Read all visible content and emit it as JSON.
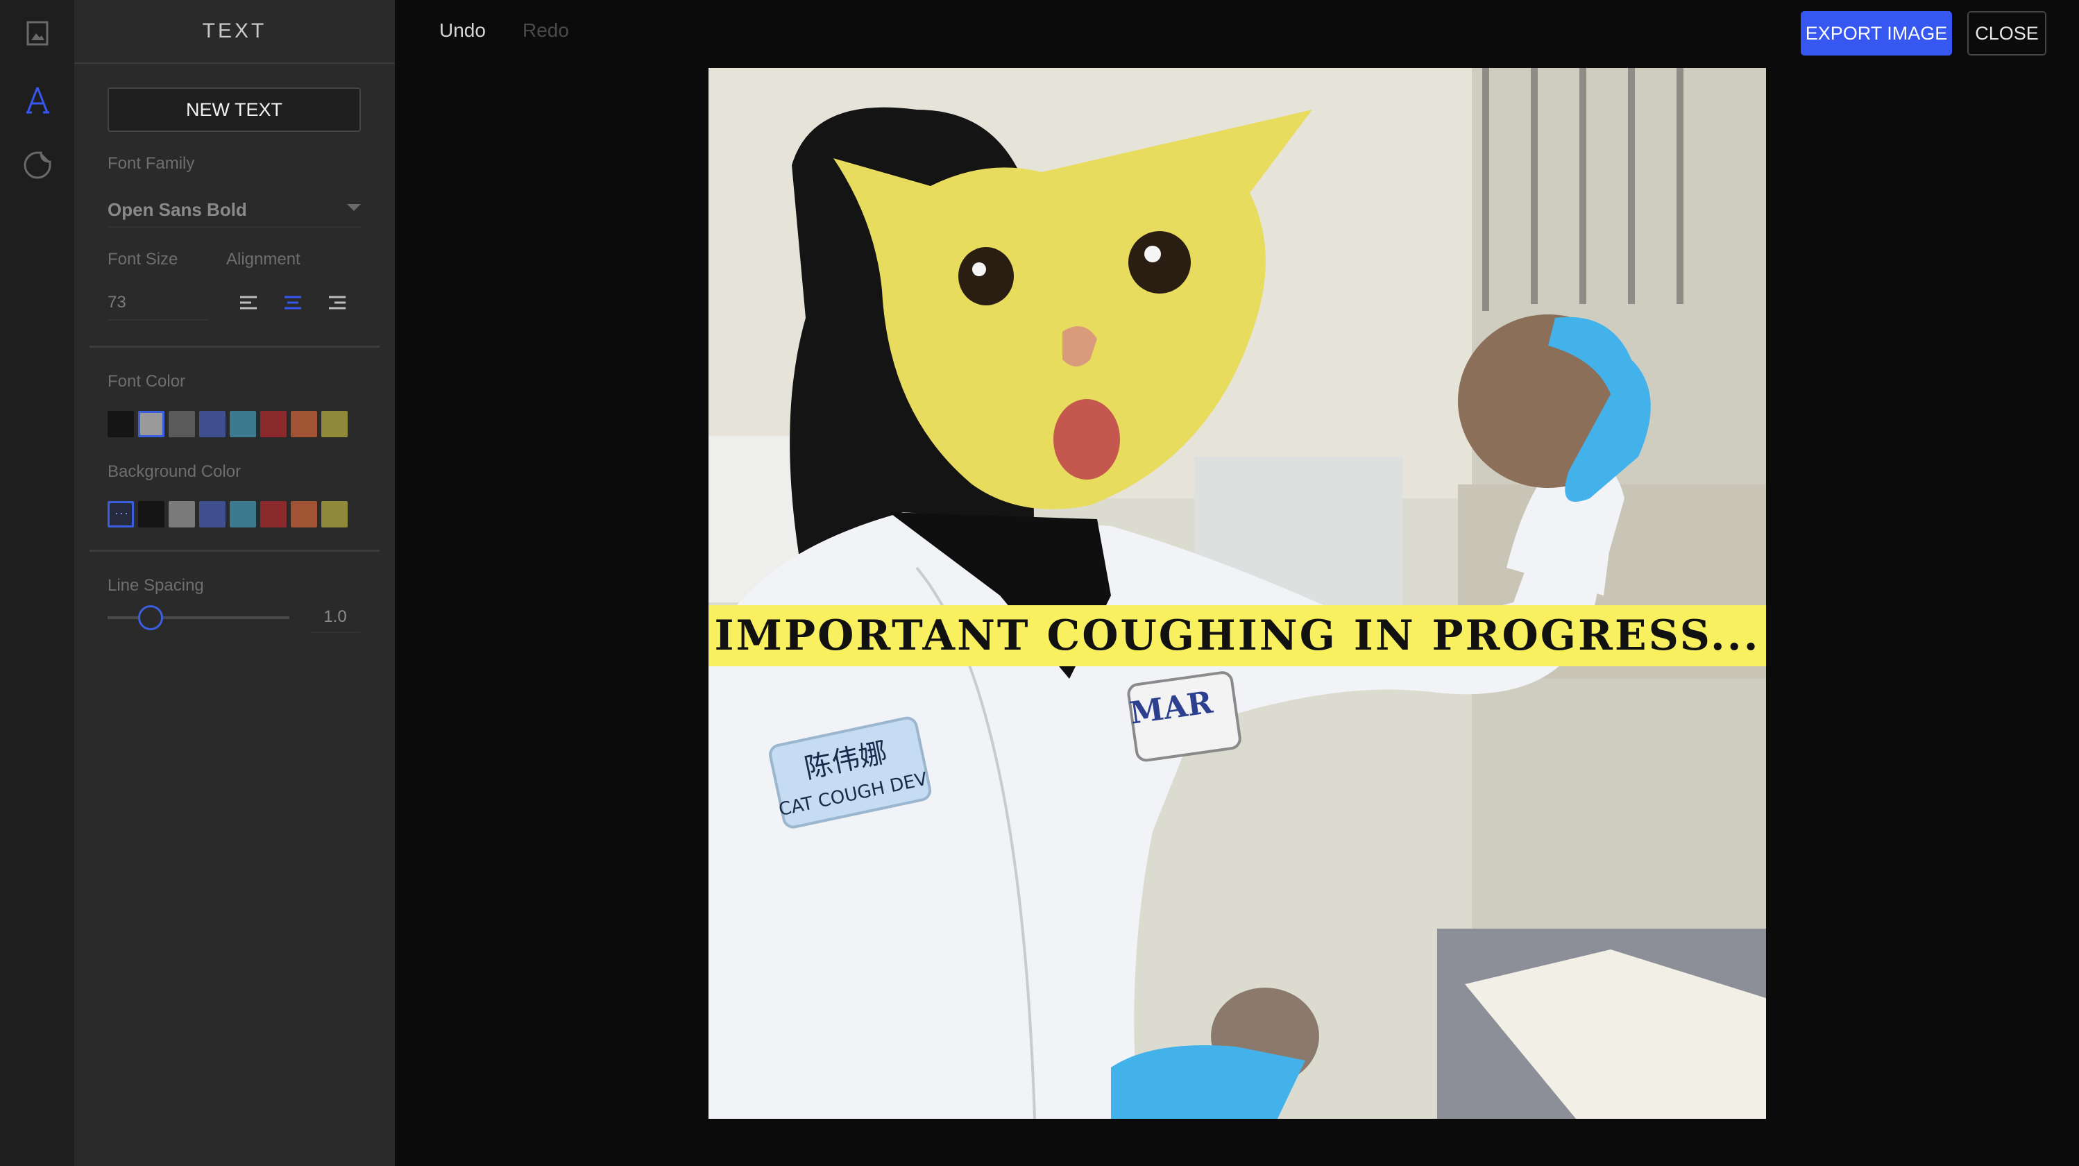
{
  "panel": {
    "title": "TEXT",
    "new_text_label": "NEW TEXT",
    "font_family_label": "Font Family",
    "font_family_value": "Open Sans Bold",
    "font_size_label": "Font Size",
    "font_size_value": "73",
    "alignment_label": "Alignment",
    "alignment_selected": "center",
    "font_color_label": "Font Color",
    "font_colors": [
      "#151515",
      "#9a9a9a",
      "#5a5a5a",
      "#3f4e8f",
      "#3c7a8f",
      "#8a2a2c",
      "#a05434",
      "#8f8a3a"
    ],
    "font_color_selected": 1,
    "background_color_label": "Background Color",
    "background_colors": [
      "none",
      "#151515",
      "#7a7a7a",
      "#3f4e8f",
      "#3c7a8f",
      "#8a2a2c",
      "#a05434",
      "#8f8a3a"
    ],
    "background_color_selected": 0,
    "line_spacing_label": "Line Spacing",
    "line_spacing_value": "1.0"
  },
  "toolbar": {
    "undo_label": "Undo",
    "redo_label": "Redo",
    "export_label": "EXPORT IMAGE",
    "close_label": "CLOSE"
  },
  "canvas": {
    "banner_text": "IMPORTANT COUGHING IN PROGRESS...",
    "name_tag_text": "陈伟娜",
    "name_tag_sub": "CAT COUGH DEV",
    "badge_text": "MAR"
  },
  "colors": {
    "accent": "#3658f0",
    "banner_bg": "#f8f05e"
  }
}
